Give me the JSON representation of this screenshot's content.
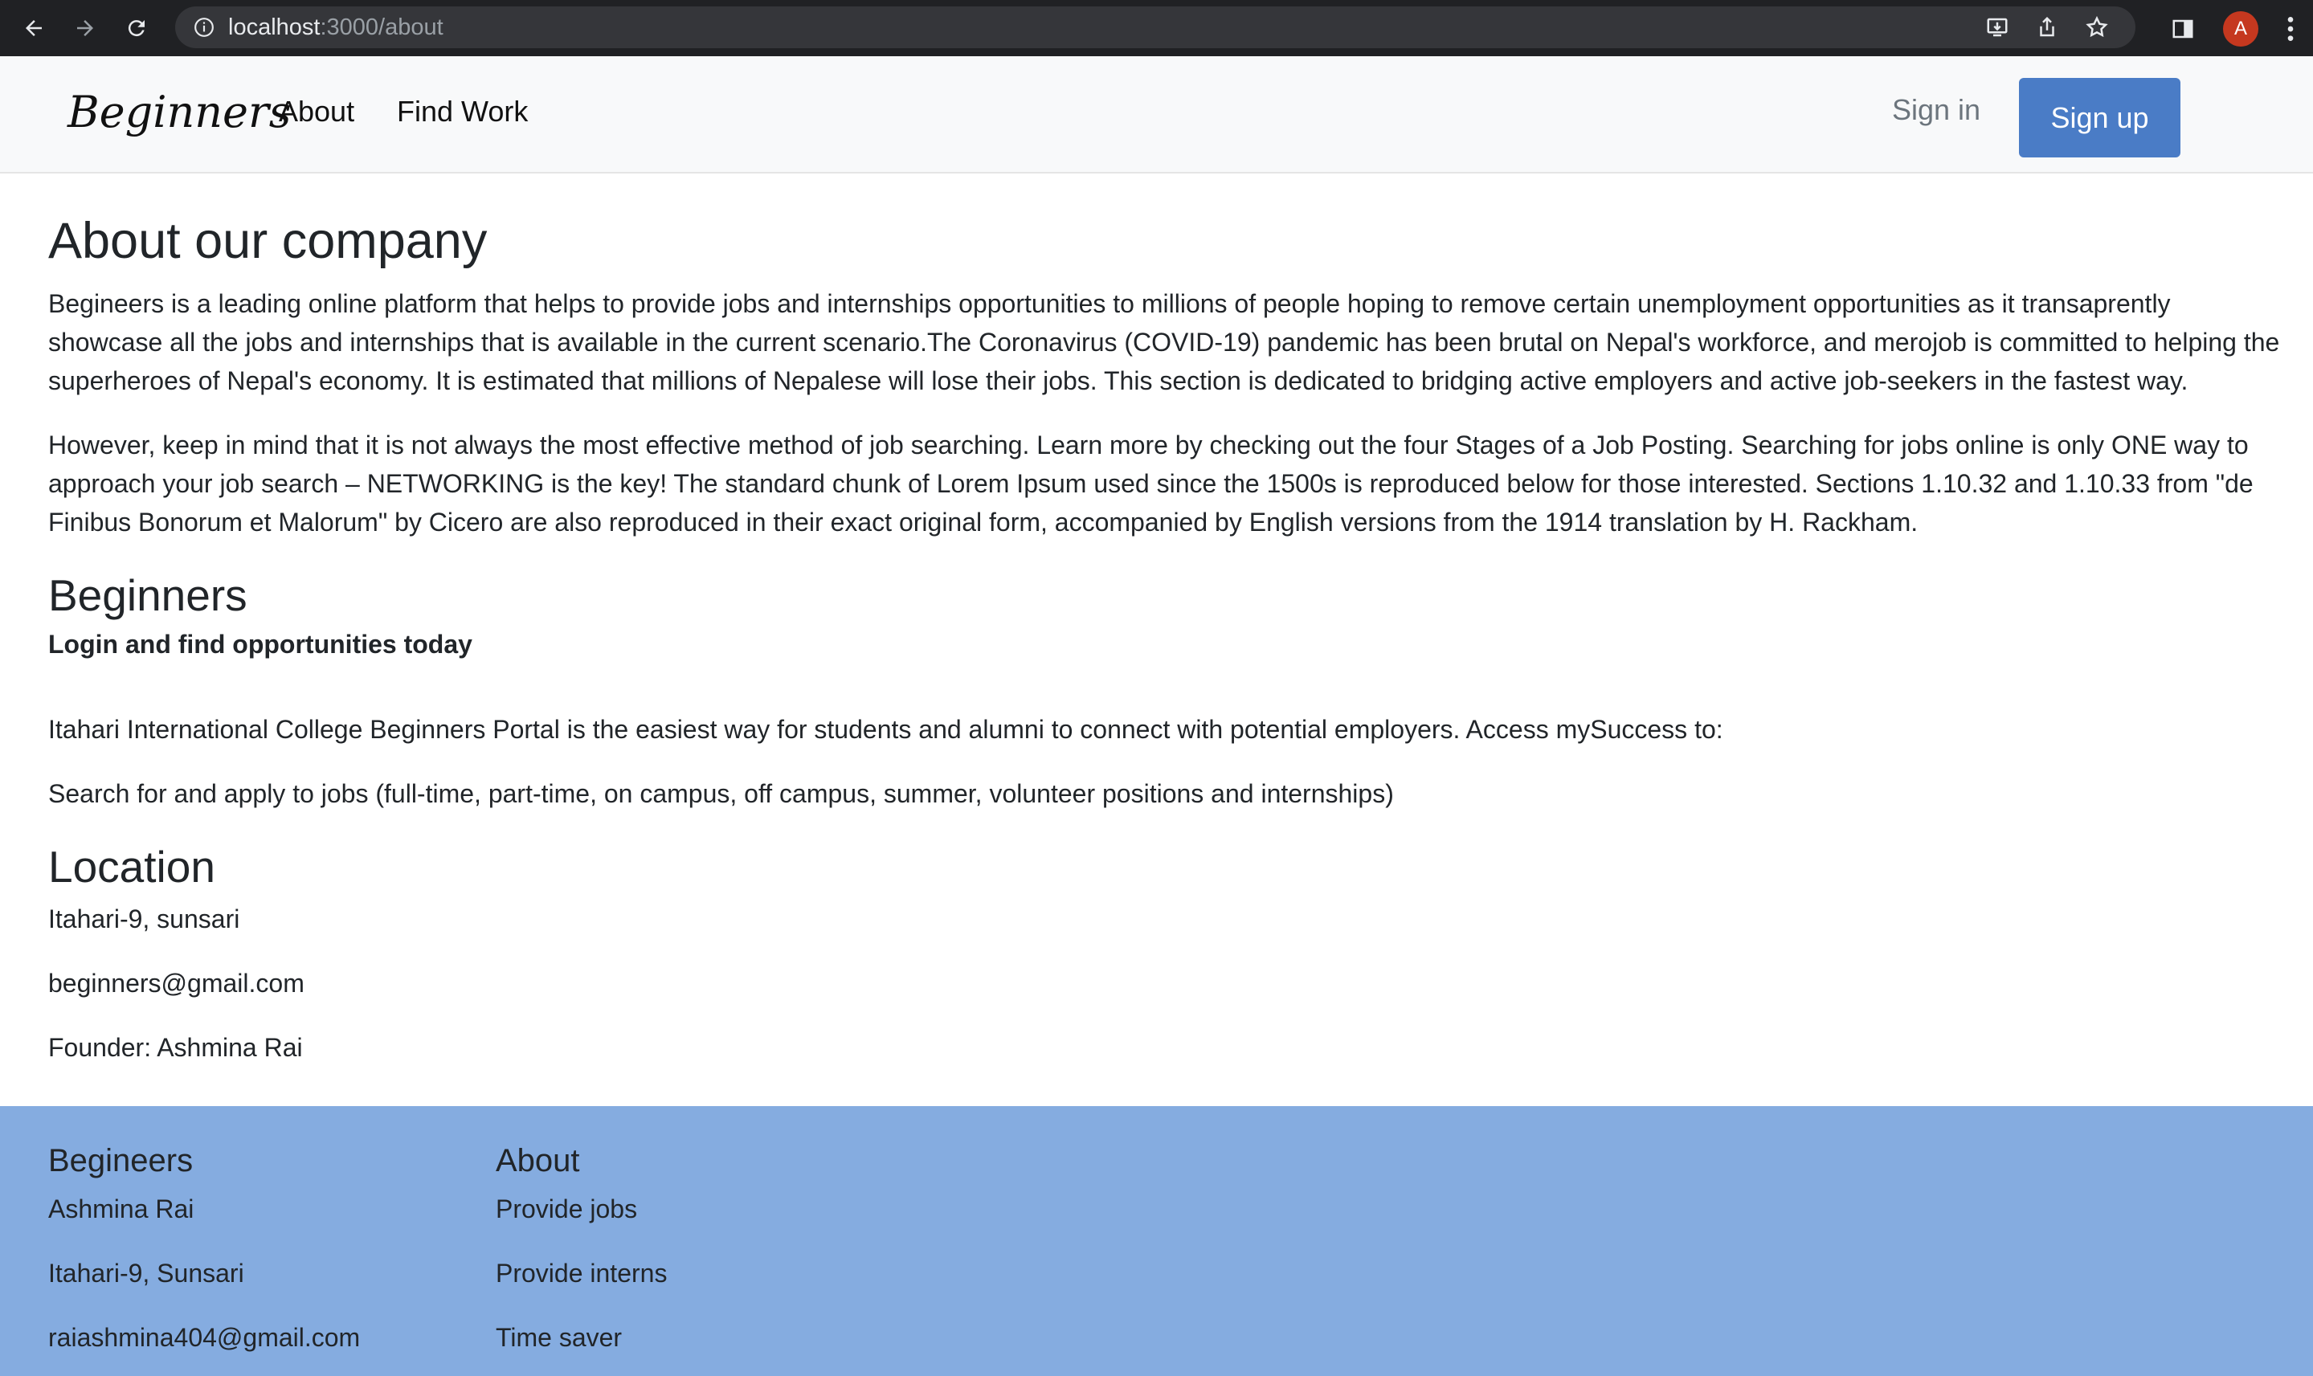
{
  "browser": {
    "url_host": "localhost",
    "url_path": ":3000/about",
    "avatar_letter": "A"
  },
  "navbar": {
    "brand": "Beginners",
    "links": [
      "About",
      "Find Work"
    ],
    "signin_label": "Sign in",
    "signup_label": "Sign up",
    "signup_color": "#4a7cc6"
  },
  "about": {
    "title": "About our company",
    "paragraph1": "Begineers is a leading online platform that helps to provide jobs and internships opportunities to millions of people hoping to remove certain unemployment opportunities as it transaprently showcase all the jobs and internships that is available in the current scenario.The Coronavirus (COVID-19) pandemic has been brutal on Nepal's workforce, and merojob is committed to helping the superheroes of Nepal's economy. It is estimated that millions of Nepalese will lose their jobs. This section is dedicated to bridging active employers and active job-seekers in the fastest way.",
    "paragraph2": "However, keep in mind that it is not always the most effective method of job searching. Learn more by checking out the four Stages of a Job Posting. Searching for jobs online is only ONE way to approach your job search – NETWORKING is the key! The standard chunk of Lorem Ipsum used since the 1500s is reproduced below for those interested. Sections 1.10.32 and 1.10.33 from \"de Finibus Bonorum et Malorum\" by Cicero are also reproduced in their exact original form, accompanied by English versions from the 1914 translation by H. Rackham."
  },
  "beginners_section": {
    "heading": "Beginners",
    "tagline": "Login and find opportunities today",
    "portal_text": "Itahari International College Beginners Portal is the easiest way for students and alumni to connect with potential employers. Access mySuccess to:",
    "search_text": "Search for and apply to jobs (full-time, part-time, on campus, off campus, summer, volunteer positions and internships)"
  },
  "location": {
    "heading": "Location",
    "address": "Itahari-9, sunsari",
    "email": "beginners@gmail.com",
    "founder": "Founder: Ashmina Rai"
  },
  "footer": {
    "background": "#85ace0",
    "col1": {
      "heading": "Begineers",
      "items": [
        "Ashmina Rai",
        "Itahari-9, Sunsari",
        "raiashmina404@gmail.com"
      ]
    },
    "col2": {
      "heading": "About",
      "items": [
        "Provide jobs",
        "Provide interns",
        "Time saver"
      ]
    }
  }
}
